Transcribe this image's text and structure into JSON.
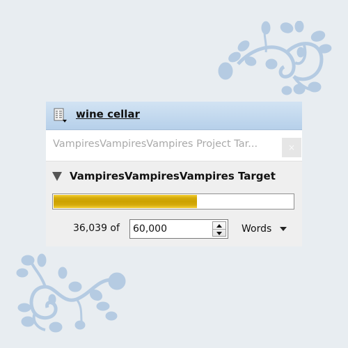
{
  "panel": {
    "title": "wine cellar",
    "title_icon": "document-menu-icon",
    "tab": {
      "label": "VampiresVampiresVampires Project Tar...",
      "close_icon": "close-icon",
      "close_glyph": "×"
    },
    "section": {
      "collapse_icon": "triangle-down-icon",
      "title": "VampiresVampiresVampires Target"
    },
    "progress": {
      "current": 36039,
      "target": 60000,
      "fraction": 0.6,
      "fill_color": "#cca200"
    },
    "count": {
      "current_text": "36,039 of",
      "target_value": "60,000",
      "spinner_up_icon": "spin-up-icon",
      "spinner_down_icon": "spin-down-icon",
      "unit_selected": "Words",
      "unit_caret_icon": "chevron-down-icon"
    }
  },
  "decorations": {
    "color": "#b5cbe2",
    "items": [
      "floral-vine-top-right",
      "floral-vine-bottom-left"
    ]
  }
}
